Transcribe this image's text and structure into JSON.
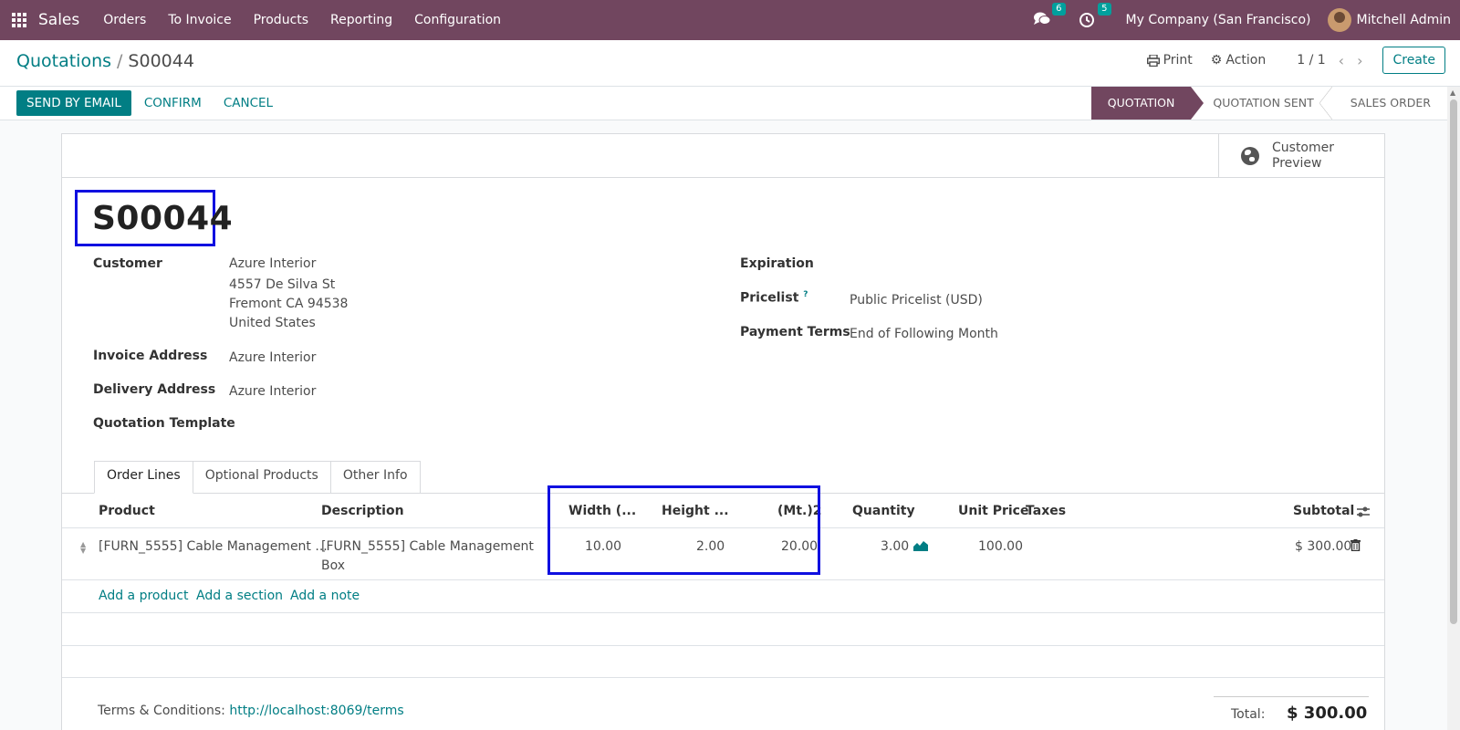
{
  "nav": {
    "app_name": "Sales",
    "menu": [
      "Orders",
      "To Invoice",
      "Products",
      "Reporting",
      "Configuration"
    ],
    "messages_count": "6",
    "activities_count": "5",
    "company": "My Company (San Francisco)",
    "user": "Mitchell Admin"
  },
  "control": {
    "breadcrumb_parent": "Quotations",
    "breadcrumb_sep": "/",
    "breadcrumb_current": "S00044",
    "print_label": "Print",
    "action_label": "Action",
    "pager": "1 / 1",
    "create_label": "Create"
  },
  "statusbar": {
    "send_email": "SEND BY EMAIL",
    "confirm": "CONFIRM",
    "cancel": "CANCEL",
    "stages": [
      "QUOTATION",
      "QUOTATION SENT",
      "SALES ORDER"
    ],
    "active_stage": "QUOTATION"
  },
  "form": {
    "preview_label": "Customer Preview",
    "title": "S00044",
    "customer_label": "Customer",
    "customer_name": "Azure Interior",
    "customer_street": "4557 De Silva St",
    "customer_city": "Fremont CA 94538",
    "customer_country": "United States",
    "invoice_label": "Invoice Address",
    "invoice_value": "Azure Interior",
    "delivery_label": "Delivery Address",
    "delivery_value": "Azure Interior",
    "template_label": "Quotation Template",
    "expiration_label": "Expiration",
    "pricelist_label": "Pricelist",
    "pricelist_help": "?",
    "pricelist_value": "Public Pricelist (USD)",
    "payment_label": "Payment Terms",
    "payment_value": "End of Following Month"
  },
  "tabs": [
    "Order Lines",
    "Optional Products",
    "Other Info"
  ],
  "order_lines": {
    "headers": {
      "product": "Product",
      "description": "Description",
      "width": "Width (...",
      "height": "Height ...",
      "area": "(Mt.)2",
      "quantity": "Quantity",
      "unit_price": "Unit Price",
      "taxes": "Taxes",
      "subtotal": "Subtotal"
    },
    "row": {
      "product": "[FURN_5555] Cable Management ...",
      "description_line1": "[FURN_5555] Cable Management",
      "description_line2": "Box",
      "width": "10.00",
      "height": "2.00",
      "area": "20.00",
      "quantity": "3.00",
      "unit_price": "100.00",
      "subtotal": "$ 300.00"
    },
    "add_product": "Add a product",
    "add_section": "Add a section",
    "add_note": "Add a note"
  },
  "footer": {
    "terms_label": "Terms & Conditions:",
    "terms_url": "http://localhost:8069/terms",
    "total_label": "Total:",
    "total_value": "$ 300.00"
  },
  "colors": {
    "brand": "#71465f",
    "accent": "#017e84",
    "highlight": "#1010e0"
  }
}
